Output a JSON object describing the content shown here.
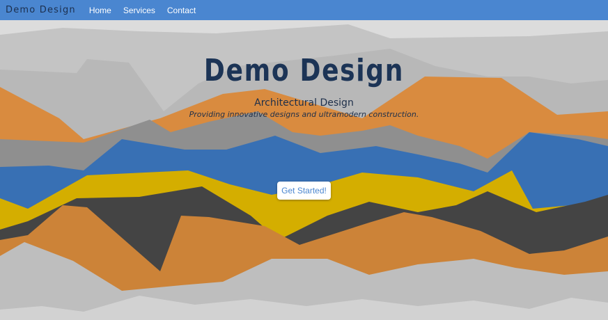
{
  "nav": {
    "brand": "Demo Design",
    "links": [
      {
        "label": "Home"
      },
      {
        "label": "Services"
      },
      {
        "label": "Contact"
      }
    ]
  },
  "hero": {
    "title": "Demo Design",
    "subtitle": "Architectural Design",
    "tagline": "Providing innovative designs and ultramodern construction.",
    "cta_label": "Get Started!"
  },
  "colors": {
    "nav_bg": "#4a86d0",
    "title": "#1c3456",
    "orange": "#d98b3f",
    "blue": "#3870b4",
    "yellow": "#d4ae00",
    "dark_gray": "#444444",
    "mid_gray": "#9a9a9a",
    "light_gray": "#c9c9c9"
  }
}
